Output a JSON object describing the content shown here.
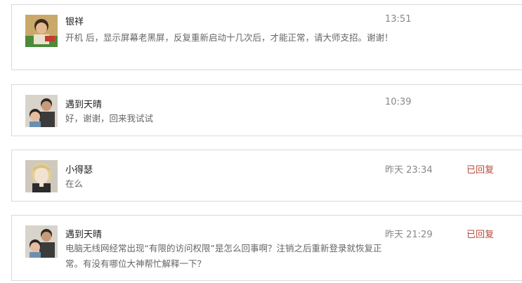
{
  "messages": [
    {
      "name": "银祥",
      "text": "开机 后，显示屏幕老黑屏，反复重新启动十几次后，才能正常，请大师支招。谢谢！",
      "time": "13:51",
      "status": ""
    },
    {
      "name": "遇到天晴",
      "text": "好，谢谢，回来我试试",
      "time": "10:39",
      "status": ""
    },
    {
      "name": "小得瑟",
      "text": "在么",
      "time": "昨天 23:34",
      "status": "已回复"
    },
    {
      "name": "遇到天晴",
      "text": "电脑无线网经常出现“有限的访问权限”是怎么回事啊？注销之后重新登录就恢复正常。有没有哪位大神帮忙解释一下？",
      "time": "昨天 21:29",
      "status": "已回复"
    }
  ],
  "colors": {
    "status": "#b84a3a",
    "border": "#d9d9d9"
  }
}
